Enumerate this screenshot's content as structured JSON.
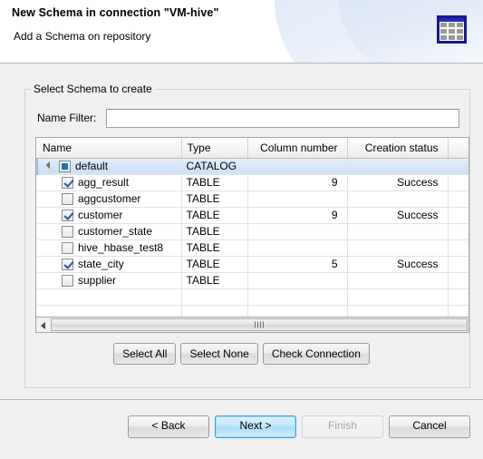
{
  "header": {
    "title": "New Schema in connection \"VM-hive\"",
    "subtitle": "Add a Schema on repository",
    "icon": "table-grid-icon"
  },
  "group": {
    "legend": "Select Schema to create"
  },
  "filter": {
    "label": "Name Filter:",
    "value": "",
    "placeholder": ""
  },
  "table": {
    "columns": [
      {
        "label": "Name",
        "align": "left"
      },
      {
        "label": "Type",
        "align": "left"
      },
      {
        "label": "Column number",
        "align": "right"
      },
      {
        "label": "Creation status",
        "align": "right"
      },
      {
        "label": "",
        "align": "left"
      }
    ],
    "rows": [
      {
        "name": "default",
        "type": "CATALOG",
        "columns": "",
        "status": "",
        "level": 0,
        "checkbox": "partial",
        "expanded": true,
        "selected": true
      },
      {
        "name": "agg_result",
        "type": "TABLE",
        "columns": "9",
        "status": "Success",
        "level": 1,
        "checkbox": "checked",
        "expanded": false,
        "selected": false
      },
      {
        "name": "aggcustomer",
        "type": "TABLE",
        "columns": "",
        "status": "",
        "level": 1,
        "checkbox": "unchecked",
        "expanded": false,
        "selected": false
      },
      {
        "name": "customer",
        "type": "TABLE",
        "columns": "9",
        "status": "Success",
        "level": 1,
        "checkbox": "checked",
        "expanded": false,
        "selected": false
      },
      {
        "name": "customer_state",
        "type": "TABLE",
        "columns": "",
        "status": "",
        "level": 1,
        "checkbox": "unchecked",
        "expanded": false,
        "selected": false
      },
      {
        "name": "hive_hbase_test8",
        "type": "TABLE",
        "columns": "",
        "status": "",
        "level": 1,
        "checkbox": "unchecked",
        "expanded": false,
        "selected": false
      },
      {
        "name": "state_city",
        "type": "TABLE",
        "columns": "5",
        "status": "Success",
        "level": 1,
        "checkbox": "checked",
        "expanded": false,
        "selected": false
      },
      {
        "name": "supplier",
        "type": "TABLE",
        "columns": "",
        "status": "",
        "level": 1,
        "checkbox": "unchecked",
        "expanded": false,
        "selected": false
      },
      {
        "name": "",
        "type": "",
        "columns": "",
        "status": "",
        "level": 0,
        "checkbox": "none",
        "expanded": false,
        "selected": false
      },
      {
        "name": "",
        "type": "",
        "columns": "",
        "status": "",
        "level": 0,
        "checkbox": "none",
        "expanded": false,
        "selected": false
      }
    ]
  },
  "scrollbar": {
    "orientation": "horizontal",
    "left_arrow": "scroll-left-arrow"
  },
  "actions": {
    "select_all": "Select All",
    "select_none": "Select None",
    "check_connection": "Check Connection"
  },
  "footer": {
    "back": "< Back",
    "next": "Next >",
    "finish": "Finish",
    "cancel": "Cancel",
    "default_button": "Next >",
    "disabled_buttons": [
      "Finish"
    ]
  },
  "colors": {
    "selection_blue": "#cfe0f4",
    "icon_border": "#18188c",
    "default_button_border": "#3c9fd4",
    "dialog_background": "#f0f0f0"
  }
}
